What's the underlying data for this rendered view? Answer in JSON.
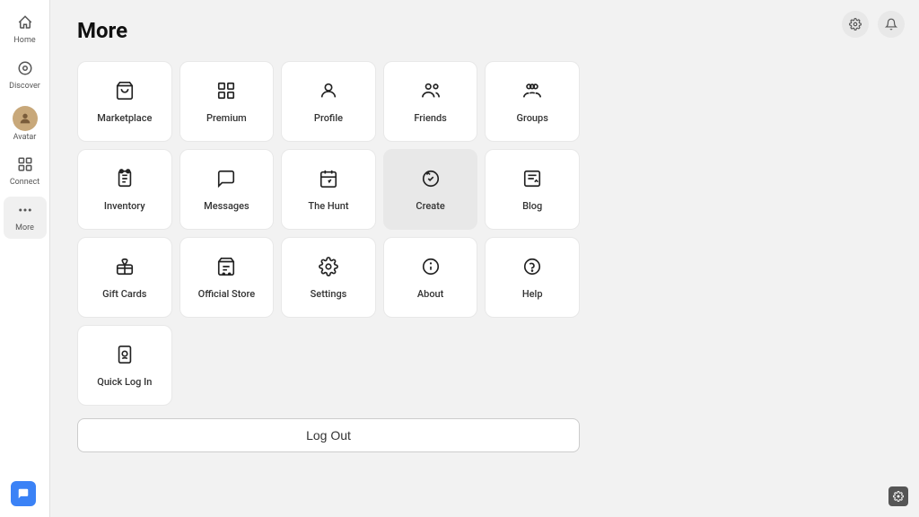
{
  "page": {
    "title": "More"
  },
  "sidebar": {
    "items": [
      {
        "id": "home",
        "label": "Home",
        "icon": "⊞"
      },
      {
        "id": "discover",
        "label": "Discover",
        "icon": "🔍"
      },
      {
        "id": "avatar",
        "label": "Avatar",
        "icon": "avatar"
      },
      {
        "id": "connect",
        "label": "Connect",
        "icon": "⊡"
      },
      {
        "id": "more",
        "label": "More",
        "icon": "···",
        "active": true
      }
    ]
  },
  "grid": {
    "rows": [
      [
        {
          "id": "marketplace",
          "label": "Marketplace",
          "icon": "🛍"
        },
        {
          "id": "premium",
          "label": "Premium",
          "icon": "⊞"
        },
        {
          "id": "profile",
          "label": "Profile",
          "icon": "👤"
        },
        {
          "id": "friends",
          "label": "Friends",
          "icon": "👥"
        },
        {
          "id": "groups",
          "label": "Groups",
          "icon": "👥"
        }
      ],
      [
        {
          "id": "inventory",
          "label": "Inventory",
          "icon": "🎒"
        },
        {
          "id": "messages",
          "label": "Messages",
          "icon": "💬"
        },
        {
          "id": "thehunt",
          "label": "The Hunt",
          "icon": "📅"
        },
        {
          "id": "create",
          "label": "Create",
          "icon": "⚙",
          "highlighted": true
        },
        {
          "id": "blog",
          "label": "Blog",
          "icon": "📋"
        }
      ],
      [
        {
          "id": "giftcards",
          "label": "Gift Cards",
          "icon": "🎁"
        },
        {
          "id": "officialstore",
          "label": "Official Store",
          "icon": "🛒"
        },
        {
          "id": "settings",
          "label": "Settings",
          "icon": "⚙"
        },
        {
          "id": "about",
          "label": "About",
          "icon": "ℹ"
        },
        {
          "id": "help",
          "label": "Help",
          "icon": "❓"
        }
      ],
      [
        {
          "id": "quicklogin",
          "label": "Quick Log In",
          "icon": "🔒"
        }
      ]
    ],
    "logout_label": "Log Out"
  },
  "topbar": {
    "settings_icon": "⚙",
    "notification_icon": "🔔"
  },
  "bottom": {
    "chat_icon": "💬",
    "settings_icon": "⚙"
  }
}
